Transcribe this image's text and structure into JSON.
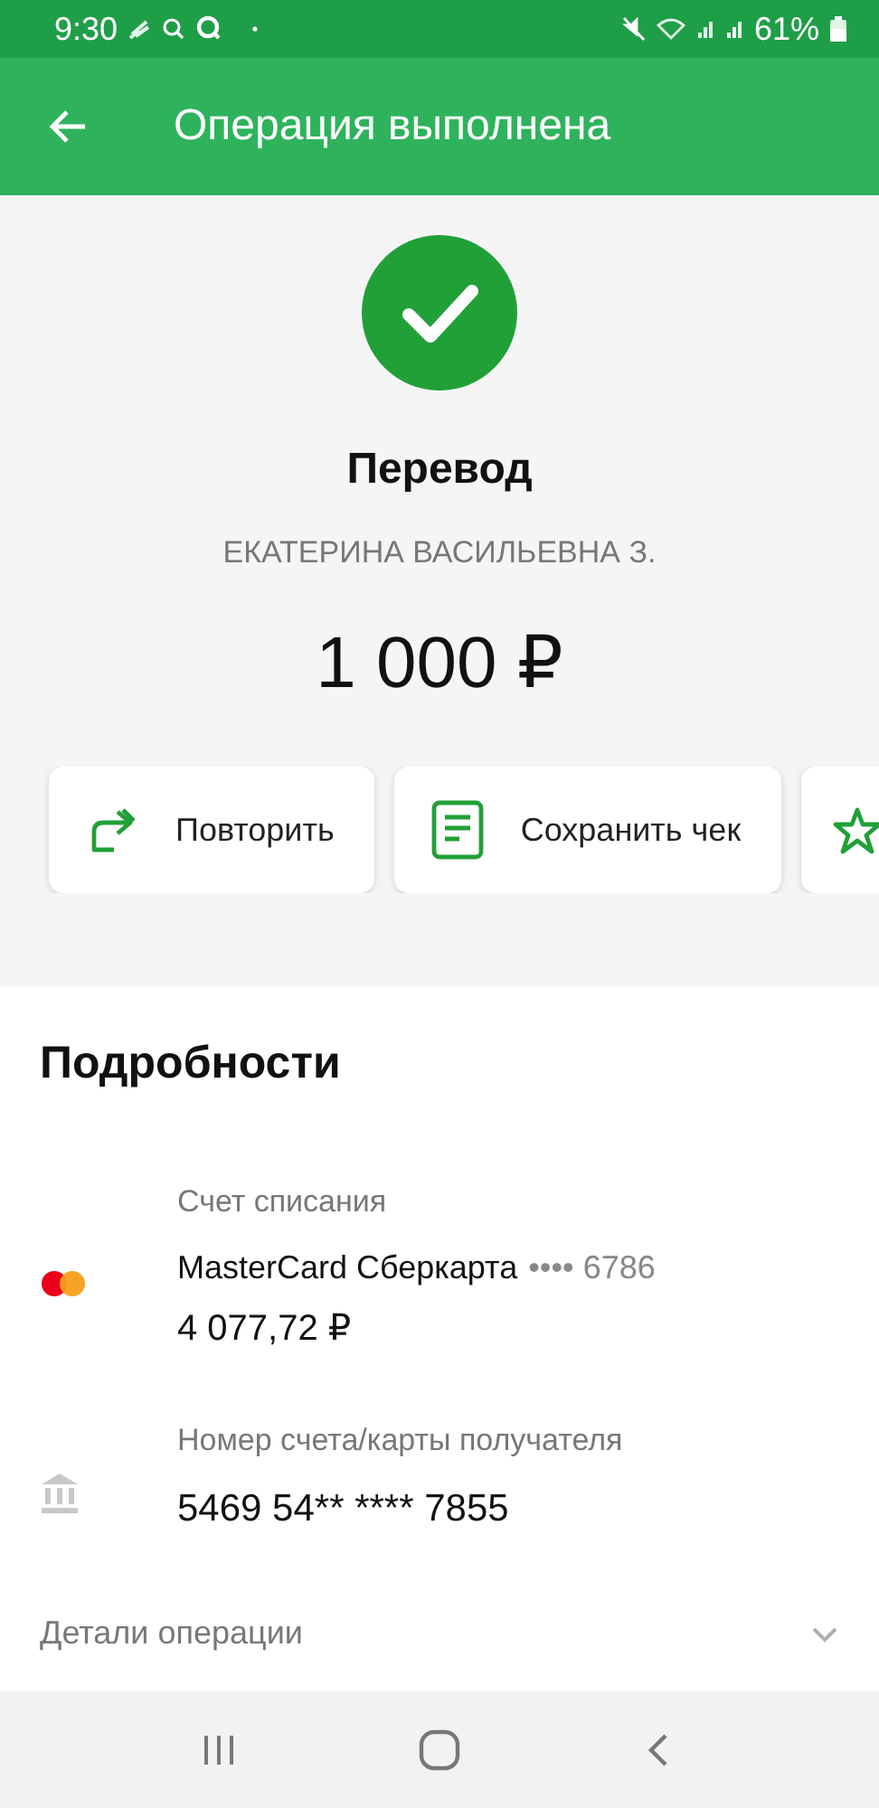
{
  "status_bar": {
    "time": "9:30",
    "battery": "61%"
  },
  "app_bar": {
    "title": "Операция выполнена"
  },
  "result": {
    "title": "Перевод",
    "recipient": "ЕКАТЕРИНА ВАСИЛЬЕВНА З.",
    "amount": "1 000 ₽"
  },
  "actions": [
    {
      "kind": "repeat",
      "label": "Повторить"
    },
    {
      "kind": "receipt",
      "label": "Сохранить чек"
    },
    {
      "kind": "star"
    }
  ],
  "details": {
    "title": "Подробности",
    "items": [
      {
        "kind": "card",
        "label": "Счет списания",
        "name": "MasterCard Сберкарта",
        "mask": "•••• 6786",
        "value": "4 077,72 ₽"
      },
      {
        "kind": "bank",
        "label": "Номер счета/карты получателя",
        "value": "5469 54** **** 7855"
      }
    ],
    "more": {
      "label": "Детали операции",
      "expanded": false
    }
  }
}
